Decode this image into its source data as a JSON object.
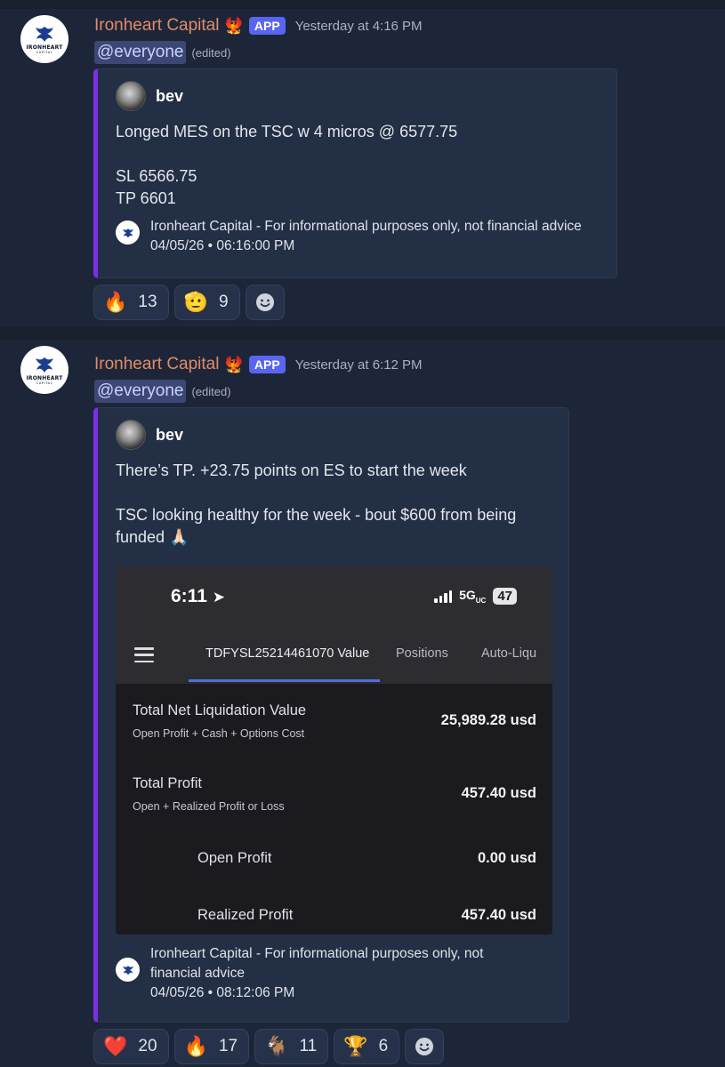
{
  "messages": [
    {
      "author": "Ironheart Capital",
      "badge_emoji": "🐦‍🔥",
      "app_badge": "APP",
      "timestamp": "Yesterday at 4:16 PM",
      "mention": "@everyone",
      "edited": "(edited)",
      "avatar_text": "IRONHEART",
      "avatar_subtext": "CAPITAL",
      "embed": {
        "author_name": "bev",
        "text_lines": [
          "Longed MES on the TSC w 4 micros @ 6577.75",
          "SL 6566.75",
          "TP 6601"
        ],
        "footer_line1": "Ironheart Capital - For informational purposes only, not financial advice",
        "footer_line2": "04/05/26  •  06:16:00 PM"
      },
      "reactions": [
        {
          "emoji": "🔥",
          "count": "13"
        },
        {
          "emoji": "🫡",
          "count": "9"
        }
      ]
    },
    {
      "author": "Ironheart Capital",
      "badge_emoji": "🐦‍🔥",
      "app_badge": "APP",
      "timestamp": "Yesterday at 6:12 PM",
      "mention": "@everyone",
      "edited": "(edited)",
      "avatar_text": "IRONHEART",
      "avatar_subtext": "CAPITAL",
      "embed": {
        "author_name": "bev",
        "text_lines": [
          "There’s TP. +23.75 points on ES to start the week",
          "TSC looking healthy for the week - bout $600 from being",
          "funded 🙏🏻"
        ],
        "footer_line1": "Ironheart Capital - For informational purposes only, not",
        "footer_line1b": "financial advice",
        "footer_line2": "04/05/26  •  08:12:06 PM"
      },
      "reactions": [
        {
          "emoji": "❤️",
          "count": "20"
        },
        {
          "emoji": "🔥",
          "count": "17"
        },
        {
          "emoji": "🐐",
          "count": "11"
        },
        {
          "emoji": "🏆",
          "count": "6"
        }
      ]
    }
  ],
  "screenshot": {
    "time": "6:11",
    "network": "5G",
    "network_sub": "UC",
    "battery": "47",
    "tabs": [
      "TDFYSL25214461070 Value",
      "Positions",
      "Auto-Liqu"
    ],
    "rows": [
      {
        "label": "Total Net Liquidation Value",
        "sub": "Open Profit + Cash + Options Cost",
        "value": "25,989.28 usd"
      },
      {
        "label": "Total Profit",
        "sub": "Open + Realized Profit or Loss",
        "value": "457.40 usd"
      },
      {
        "label": "Open Profit",
        "value": "0.00 usd"
      },
      {
        "label": "Realized Profit",
        "value": "457.40 usd"
      }
    ]
  },
  "colors": {
    "background": "#1c2535",
    "username": "#e38a6a",
    "app_badge": "#5865f2",
    "embed_border": "#7c2ee8",
    "mention_bg": "#3d4775"
  }
}
